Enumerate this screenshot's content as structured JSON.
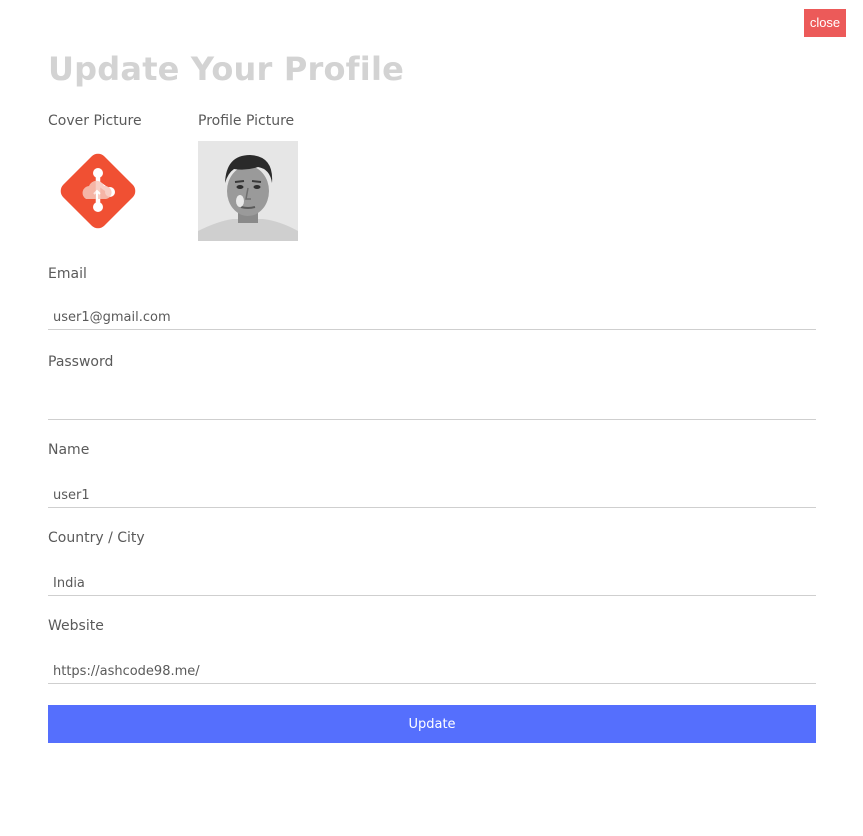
{
  "header": {
    "close_label": "close",
    "title": "Update Your Profile"
  },
  "pictures": {
    "cover_label": "Cover Picture",
    "profile_label": "Profile Picture",
    "cover_icon": "git-logo-icon",
    "profile_image": "user-portrait-photo"
  },
  "form": {
    "email": {
      "label": "Email",
      "value": "user1@gmail.com"
    },
    "password": {
      "label": "Password",
      "value": ""
    },
    "name": {
      "label": "Name",
      "value": "user1"
    },
    "location": {
      "label": "Country / City",
      "value": "India"
    },
    "website": {
      "label": "Website",
      "value": "https://ashcode98.me/"
    }
  },
  "actions": {
    "update_label": "Update"
  },
  "colors": {
    "close_bg": "#ec5a59",
    "update_bg": "#556ffd",
    "title": "#d3d3d3",
    "git_logo": "#f05033"
  }
}
